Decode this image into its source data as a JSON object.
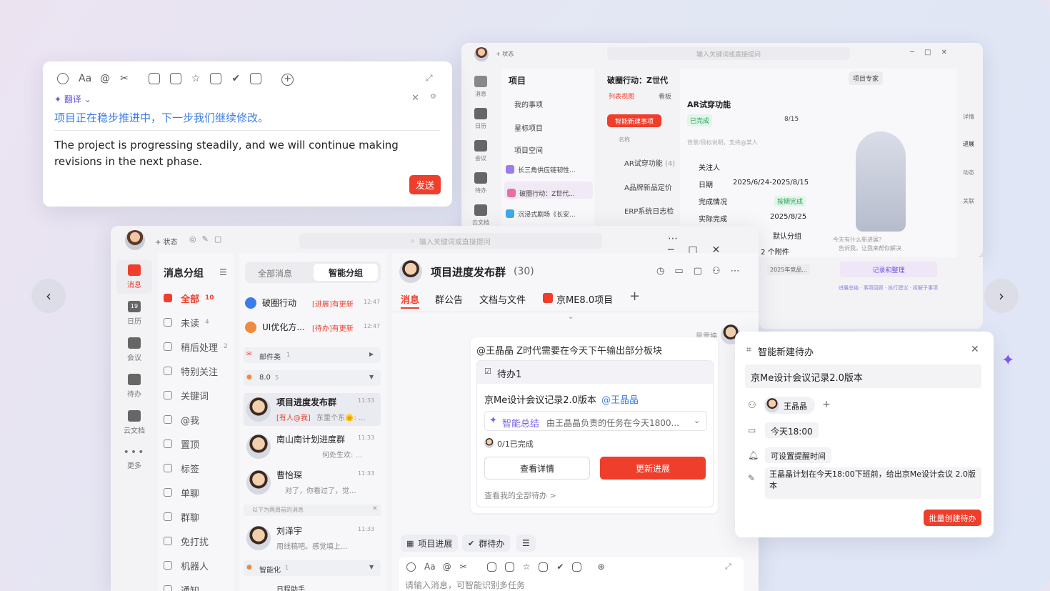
{
  "translate_card": {
    "translate_label": "翻译",
    "source_text": "项目正在稳步推进中，下一步我们继续修改。",
    "translated_text": "The project is progressing steadily, and we will continue making revisions in the next phase.",
    "send_label": "发送"
  },
  "back_window": {
    "search_placeholder": "输入关键词或直接提问",
    "status_label": "+ 状态",
    "nav": [
      "消息",
      "日历",
      "会议",
      "待办",
      "云文档"
    ],
    "project_panel": {
      "title": "项目",
      "items": [
        "我的事项",
        "星标项目",
        "项目空间"
      ],
      "projects": [
        "长三角供应链韧性...",
        "破圈行动：Z世代...",
        "沉浸式剧场《长安..."
      ]
    },
    "board": {
      "title": "破圈行动：Z世代",
      "tab_list": "列表视图",
      "tab_board": "看板",
      "smart_new": "智能新建事项",
      "col_name": "名称",
      "rows": [
        "AR试穿功能",
        "A品牌新品定价",
        "ERP系统日志检"
      ],
      "row1_count": "(4)"
    },
    "detail": {
      "expert": "项目专家",
      "title": "AR试穿功能",
      "status": "已完成",
      "progress": "8/15",
      "desc_placeholder": "背景/目标说明，支持@某人",
      "follower_label": "关注人",
      "date_label": "日期",
      "date_value": "2025/6/24-2025/8/15",
      "completion_label": "完成情况",
      "completion_value": "按期完成",
      "actual_label": "实际完成",
      "actual_value": "2025/8/25",
      "group_value": "默认分组",
      "attachments": "关 2 个附件",
      "file": "2025年竞品..."
    },
    "assistant": {
      "question": "今天有什么新进展？",
      "hint": "告诉我，让我来帮你解决",
      "button": "记录和整理",
      "links": "进展总结 · 事项回顾 · 执行建议 · 拆解子事项"
    },
    "side_nav": [
      "详情",
      "进展",
      "动态",
      "关联"
    ]
  },
  "front_window": {
    "search_placeholder": "输入关键词或直接提问",
    "status_label": "+ 状态",
    "nav": [
      "消息",
      "日历",
      "会议",
      "待办",
      "云文档",
      "更多"
    ],
    "calendar_day": "19",
    "groups_title": "消息分组",
    "groups": [
      {
        "label": "全部",
        "count": "10"
      },
      {
        "label": "未读",
        "count": "4"
      },
      {
        "label": "稍后处理",
        "count": "2"
      },
      {
        "label": "特别关注",
        "count": ""
      },
      {
        "label": "关键词",
        "count": ""
      },
      {
        "label": "@我",
        "count": ""
      },
      {
        "label": "置顶",
        "count": ""
      },
      {
        "label": "标签",
        "count": ""
      },
      {
        "label": "单聊",
        "count": ""
      },
      {
        "label": "群聊",
        "count": ""
      },
      {
        "label": "免打扰",
        "count": ""
      },
      {
        "label": "机器人",
        "count": ""
      },
      {
        "label": "通知",
        "count": ""
      }
    ],
    "tabs": {
      "all": "全部消息",
      "smart": "智能分组"
    },
    "pinned": [
      {
        "name": "破圈行动",
        "tag": "[进展]有更新",
        "time": "12:47"
      },
      {
        "name": "UI优化方...",
        "tag": "[待办]有更新",
        "time": "12:47"
      }
    ],
    "folder_mail": {
      "label": "邮件类",
      "count": "1"
    },
    "folder_80": {
      "label": "8.0",
      "count": "5"
    },
    "chats": [
      {
        "name": "项目进度发布群",
        "time": "11:33",
        "tag": "[有人@我]",
        "preview": "东里个东🌞: ..."
      },
      {
        "name": "南山南计划进度群",
        "time": "11:33",
        "preview": "何处生欢: ..."
      },
      {
        "name": "曹怡琛",
        "time": "11:33",
        "preview": "对了，你看过了，觉..."
      },
      {
        "name": "刘泽宇",
        "time": "11:33",
        "preview": "用线稿吧。感觉填上..."
      }
    ],
    "older_divider": "以下为两周前的消息",
    "folder_smart": {
      "label": "智能化",
      "count": "1"
    },
    "last_partial": "日程助手",
    "chat": {
      "title": "项目进度发布群",
      "count": "(30)",
      "tabs": [
        "消息",
        "群公告",
        "文档与文件",
        "京ME8.0项目"
      ],
      "sender": "吴雪婷",
      "mention": "@王晶晶 Z时代需要在今天下午输出部分板块",
      "todo_title": "待办1",
      "todo_text": "京Me设计会议记录2.0版本",
      "todo_at": "@王晶晶",
      "smart_summary": "智能总结",
      "summary_text": "由王晶晶负责的任务在今天1800...",
      "done": "0/1已完成",
      "view_detail": "查看详情",
      "update_progress": "更新进展",
      "view_all": "查看我的全部待办 >",
      "bottom_chips": [
        "项目进展",
        "群待办"
      ],
      "input_placeholder": "请输入消息，可智能识别多任务"
    }
  },
  "todo_card": {
    "title": "智能新建待办",
    "task": "京Me设计会议记录2.0版本",
    "assignee": "王晶晶",
    "due": "今天18:00",
    "reminder": "可设置提醒时间",
    "note": "王晶晶计划在今天18:00下班前，给出京Me设计会议 2.0版本",
    "batch_button": "批量创建待办"
  }
}
